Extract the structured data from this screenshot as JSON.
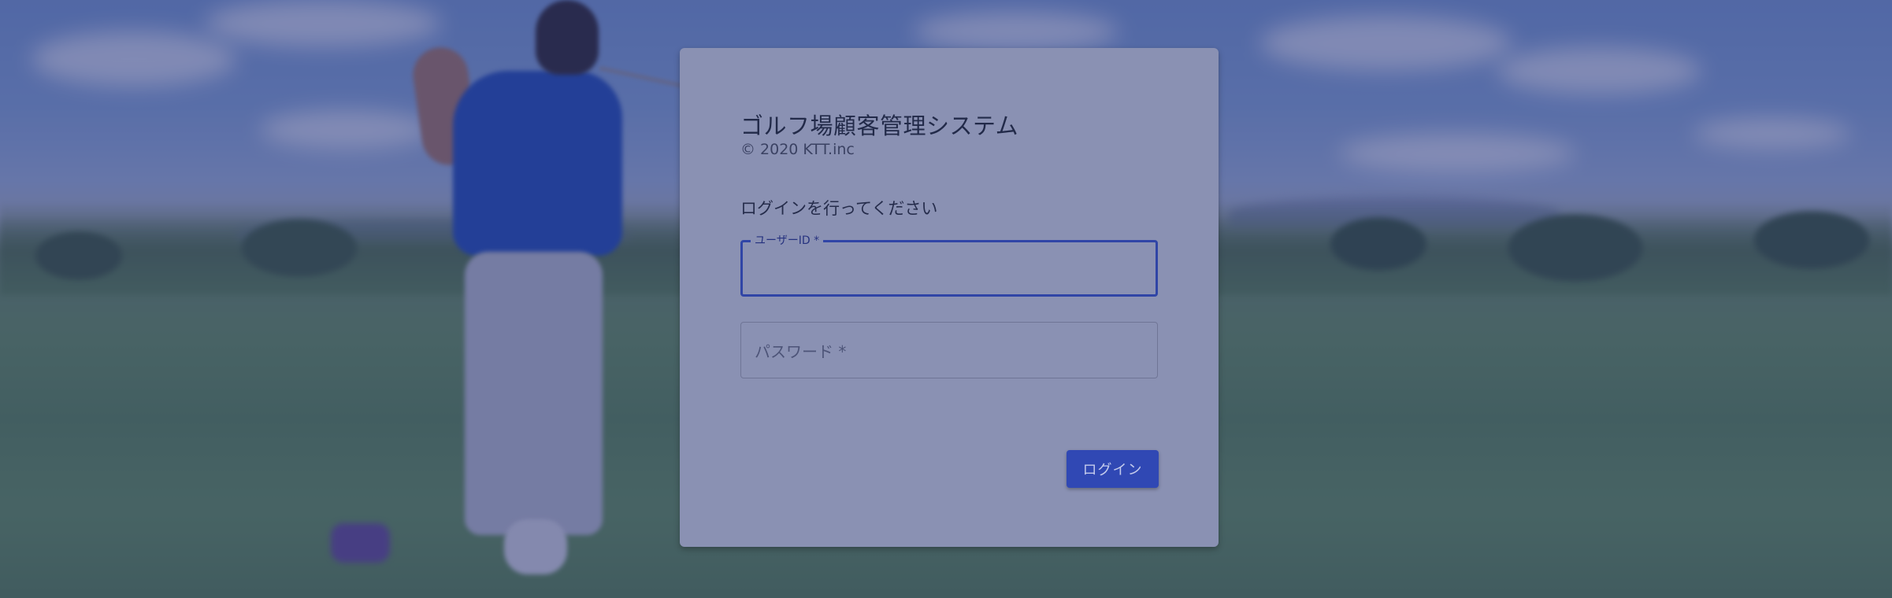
{
  "app": {
    "title": "ゴルフ場顧客管理システム",
    "copyright": "© 2020 KTT.inc"
  },
  "login": {
    "instruction": "ログインを行ってください",
    "user_id_label": "ユーザーID *",
    "user_id_value": "",
    "password_label": "パスワード *",
    "password_value": "",
    "submit_label": "ログイン"
  },
  "colors": {
    "accent": "#3048b4",
    "overlay": "#283278"
  }
}
